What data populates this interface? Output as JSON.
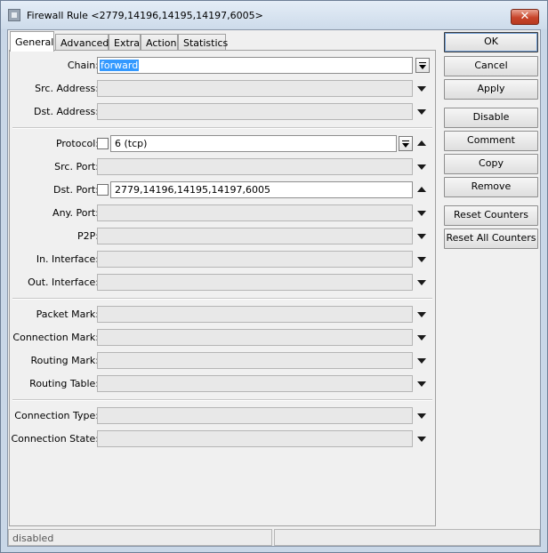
{
  "window": {
    "title": "Firewall Rule <2779,14196,14195,14197,6005>",
    "close_label": "✕"
  },
  "tabs": [
    {
      "label": "General",
      "active": true
    },
    {
      "label": "Advanced",
      "active": false
    },
    {
      "label": "Extra",
      "active": false
    },
    {
      "label": "Action",
      "active": false
    },
    {
      "label": "Statistics",
      "active": false
    }
  ],
  "form": {
    "chain": {
      "label": "Chain:",
      "value": "forward"
    },
    "src_address": {
      "label": "Src. Address:",
      "value": ""
    },
    "dst_address": {
      "label": "Dst. Address:",
      "value": ""
    },
    "protocol": {
      "label": "Protocol:",
      "value": "6 (tcp)"
    },
    "src_port": {
      "label": "Src. Port:",
      "value": ""
    },
    "dst_port": {
      "label": "Dst. Port:",
      "value": "2779,14196,14195,14197,6005"
    },
    "any_port": {
      "label": "Any. Port:",
      "value": ""
    },
    "p2p": {
      "label": "P2P:",
      "value": ""
    },
    "in_interface": {
      "label": "In. Interface:",
      "value": ""
    },
    "out_interface": {
      "label": "Out. Interface:",
      "value": ""
    },
    "packet_mark": {
      "label": "Packet Mark:",
      "value": ""
    },
    "connection_mark": {
      "label": "Connection Mark:",
      "value": ""
    },
    "routing_mark": {
      "label": "Routing Mark:",
      "value": ""
    },
    "routing_table": {
      "label": "Routing Table:",
      "value": ""
    },
    "connection_type": {
      "label": "Connection Type:",
      "value": ""
    },
    "connection_state": {
      "label": "Connection State:",
      "value": ""
    }
  },
  "buttons": {
    "ok": "OK",
    "cancel": "Cancel",
    "apply": "Apply",
    "disable": "Disable",
    "comment": "Comment",
    "copy": "Copy",
    "remove": "Remove",
    "reset_counters": "Reset Counters",
    "reset_all_counters": "Reset All Counters"
  },
  "status": {
    "state": "disabled",
    "extra": ""
  }
}
